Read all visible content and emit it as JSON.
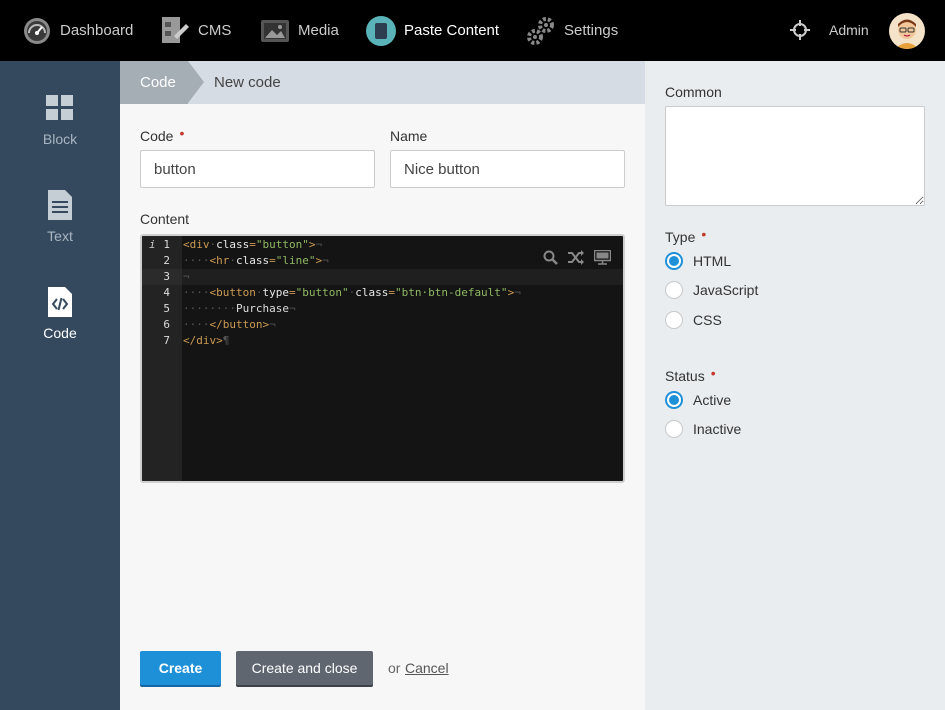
{
  "topnav": {
    "items": [
      {
        "label": "Dashboard",
        "icon": "speedometer-icon"
      },
      {
        "label": "CMS",
        "icon": "document-flow-icon"
      },
      {
        "label": "Media",
        "icon": "image-icon"
      },
      {
        "label": "Paste Content",
        "icon": "clipboard-icon"
      },
      {
        "label": "Settings",
        "icon": "gears-icon"
      }
    ],
    "active": "Paste Content",
    "user_label": "Admin"
  },
  "sidebar": {
    "items": [
      {
        "label": "Block",
        "icon": "grid-icon"
      },
      {
        "label": "Text",
        "icon": "text-document-icon"
      },
      {
        "label": "Code",
        "icon": "code-file-icon"
      }
    ],
    "active": "Code"
  },
  "breadcrumb": {
    "section": "Code",
    "current": "New code"
  },
  "form": {
    "code_label": "Code",
    "code_value": "button",
    "name_label": "Name",
    "name_value": "Nice button",
    "content_label": "Content",
    "required_mark": "•"
  },
  "editor": {
    "info_marker": "i",
    "line_numbers": [
      "1",
      "2",
      "3",
      "4",
      "5",
      "6",
      "7"
    ],
    "current_line": 3
  },
  "actions": {
    "create_label": "Create",
    "create_close_label": "Create and close",
    "or_text": "or",
    "cancel_label": "Cancel"
  },
  "right_panel": {
    "common_label": "Common",
    "type_label": "Type",
    "type_options": [
      "HTML",
      "JavaScript",
      "CSS"
    ],
    "type_selected": "HTML",
    "status_label": "Status",
    "status_options": [
      "Active",
      "Inactive"
    ],
    "status_selected": "Active"
  },
  "colors": {
    "topbar": "#000000",
    "sidebar": "#34495e",
    "accent": "#1e90d8",
    "required": "#c0392b",
    "editor_bg": "#141414"
  }
}
